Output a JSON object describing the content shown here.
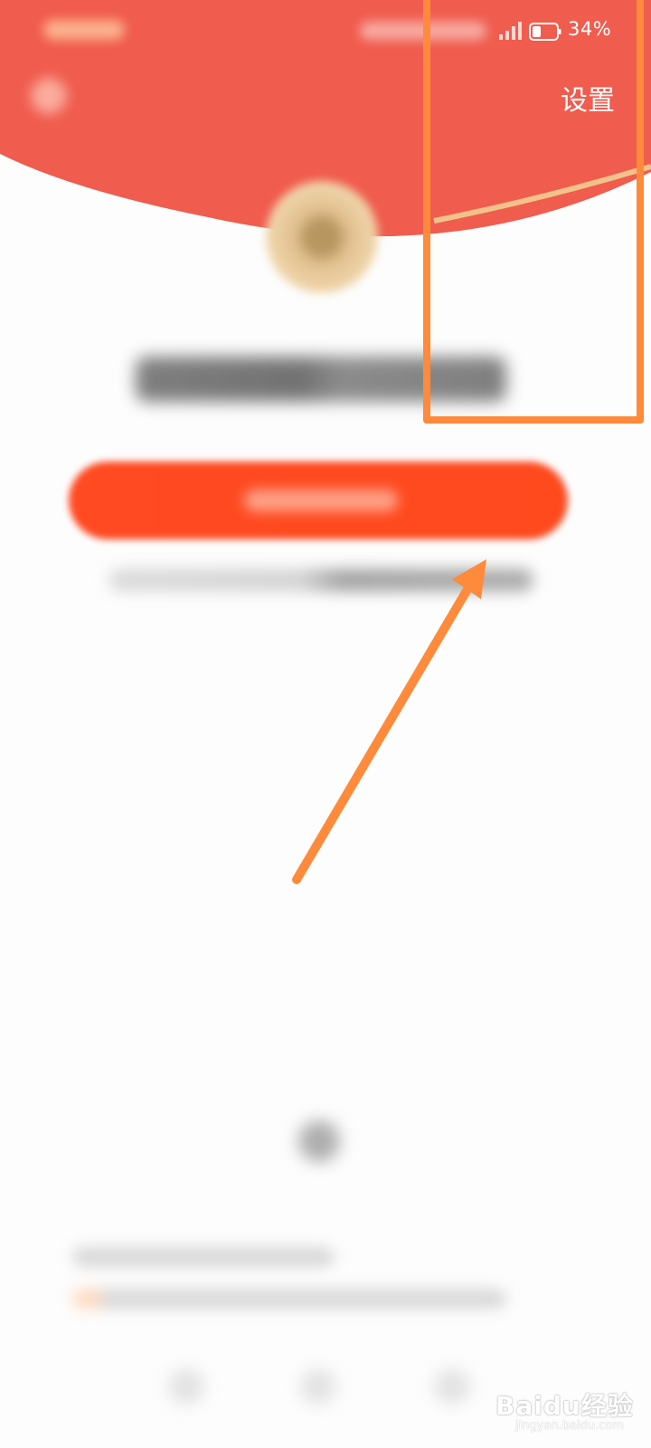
{
  "status_bar": {
    "battery_percent": "34%"
  },
  "header": {
    "settings_label": "设置"
  },
  "watermark": {
    "brand": "Baidu经验",
    "url": "jingyan.baidu.com"
  },
  "colors": {
    "header_red": "#f05c4e",
    "button_red": "#ff4a22",
    "annotation_orange": "#ff8a3c",
    "gold_arc": "#f2c28a"
  },
  "icons": {
    "back": "back-icon",
    "signal": "signal-icon",
    "battery": "battery-icon"
  }
}
